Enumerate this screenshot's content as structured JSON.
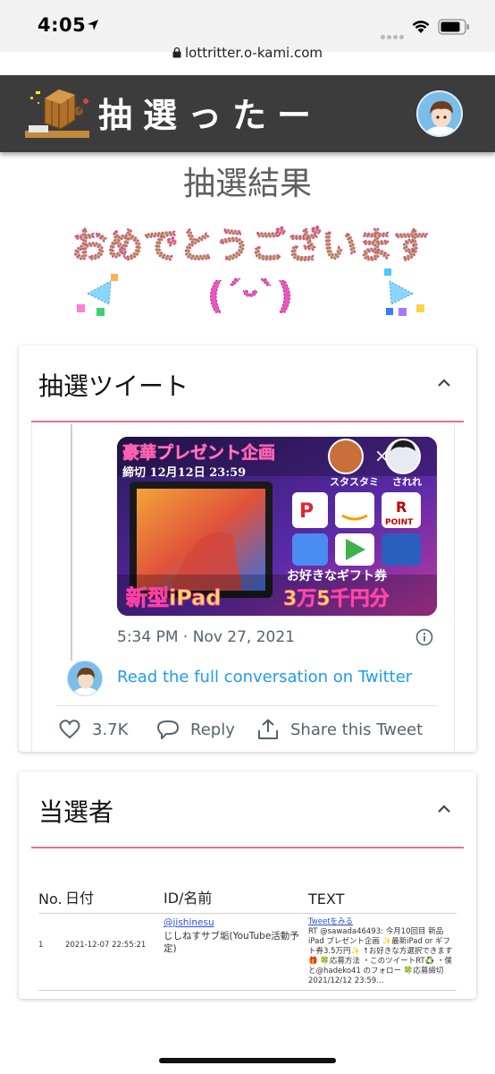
{
  "status_bar": {
    "time": "4:05",
    "url": "lottritter.o-kami.com"
  },
  "header": {
    "site_title": "抽選ったー"
  },
  "page": {
    "result_heading": "抽選結果",
    "congrats_text": "おめでとうございます"
  },
  "tweet_card": {
    "title": "抽選ツイート",
    "image_text": {
      "headline": "豪華プレゼント企画",
      "deadline": "締切 12月12日 23:59",
      "name_left": "スタスタミ",
      "name_right": "されれ",
      "point_text": "POINT",
      "product": "新型iPad",
      "gift_line1": "お好きなギフト券",
      "gift_line2": "3万5千円分"
    },
    "timestamp": "5:34 PM · Nov 27, 2021",
    "read_more": "Read the full conversation on Twitter",
    "likes": "3.7K",
    "reply_label": "Reply",
    "share_label": "Share this Tweet"
  },
  "winners_card": {
    "title": "当選者",
    "columns": [
      "No.",
      "日付",
      "ID/名前",
      "TEXT"
    ],
    "rows": [
      {
        "no": "1",
        "date": "2021-12-07 22:55:21",
        "user_id": "@jishinesu",
        "user_name": "じしねすサブ垢(YouTube活動予定)",
        "tweet_link": "Tweetをみる",
        "text": "RT @sawada46493: 今月10回目 新品iPad プレゼント企画 ✨最新iPad or ギフト券3.5万円✨ ↑お好きな方選択できます🎁 🍀応募方法 ・このツイートRT♻️ ・僕と@hadeko41 のフォロー 🍀応募締切 2021/12/12 23:59…"
      }
    ]
  },
  "colors": {
    "header_bg": "#3c3c3c",
    "accent_pink": "#e0709a",
    "link_blue": "#1d9bf0",
    "table_link": "#2a4fd8"
  }
}
